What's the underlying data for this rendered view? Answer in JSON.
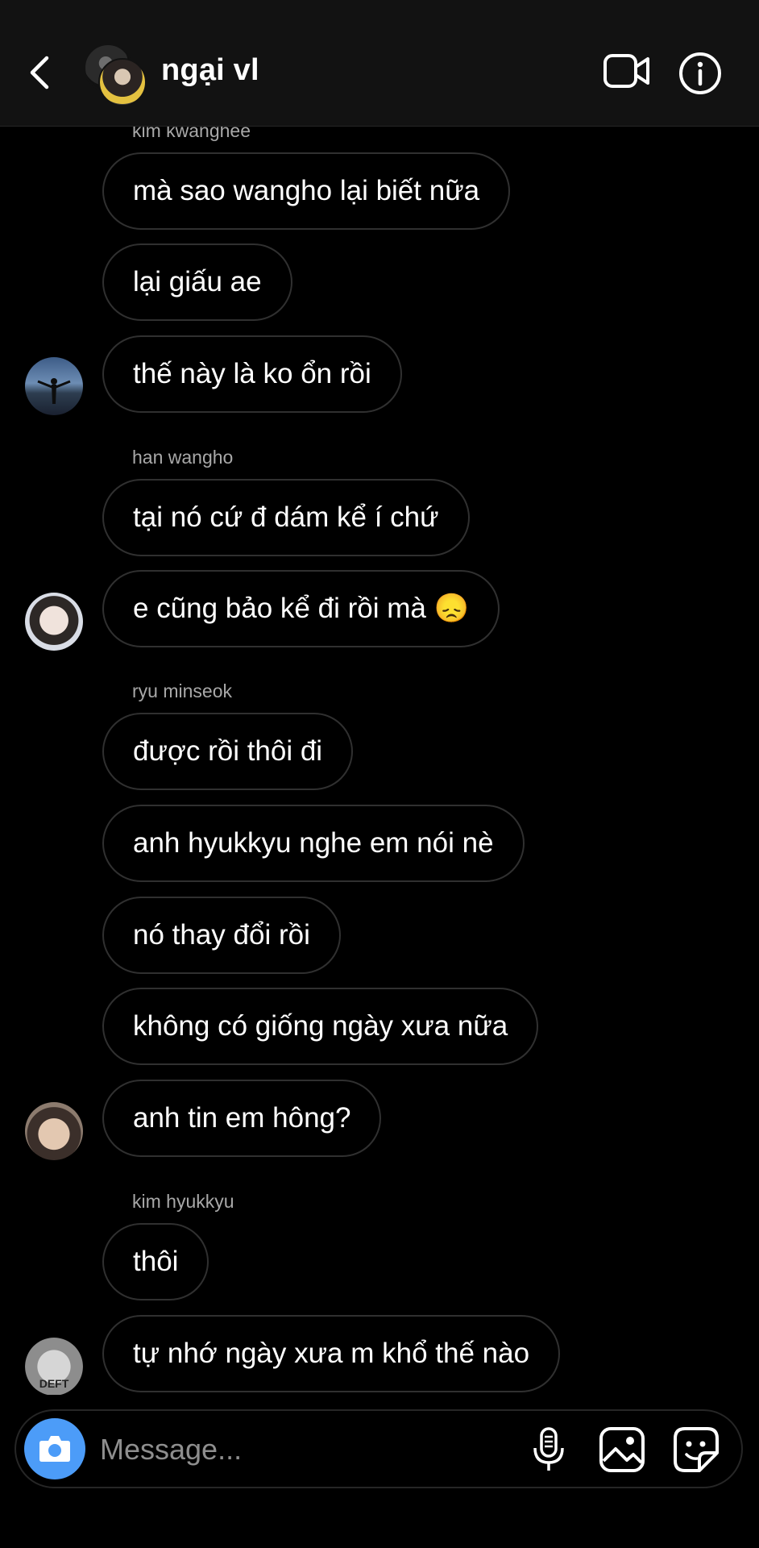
{
  "header": {
    "title": "ngại vl",
    "icons": {
      "back": "chevron-left-icon",
      "video": "video-camera-icon",
      "info": "info-icon"
    }
  },
  "messages": [
    {
      "sender": "kim kwanghee",
      "lines": [
        "mà sao wangho lại biết nữa",
        "lại giấu ae",
        "thế này là ko ổn rồi"
      ]
    },
    {
      "sender": "han wangho",
      "lines": [
        "tại nó cứ đ dám kể í chứ",
        "e cũng bảo kể đi rồi mà 😞"
      ]
    },
    {
      "sender": "ryu minseok",
      "lines": [
        "được rồi thôi đi",
        "anh hyukkyu nghe em nói nè",
        "nó thay đổi rồi",
        "không có giống ngày xưa nữa",
        "anh tin em hông?"
      ]
    },
    {
      "sender": "kim hyukkyu",
      "lines": [
        "thôi",
        "tự nhớ ngày xưa m khổ thế nào"
      ]
    }
  ],
  "avatar_texts": {
    "hyukkyu": "DEFT"
  },
  "composer": {
    "placeholder": "Message...",
    "icons": {
      "camera": "camera-icon",
      "mic": "microphone-icon",
      "gallery": "image-icon",
      "sticker": "sticker-icon"
    }
  },
  "colors": {
    "background": "#000000",
    "header": "#121212",
    "bubble_border": "#303030",
    "accent": "#4c9cf8",
    "sender": "#a8a8a8"
  }
}
